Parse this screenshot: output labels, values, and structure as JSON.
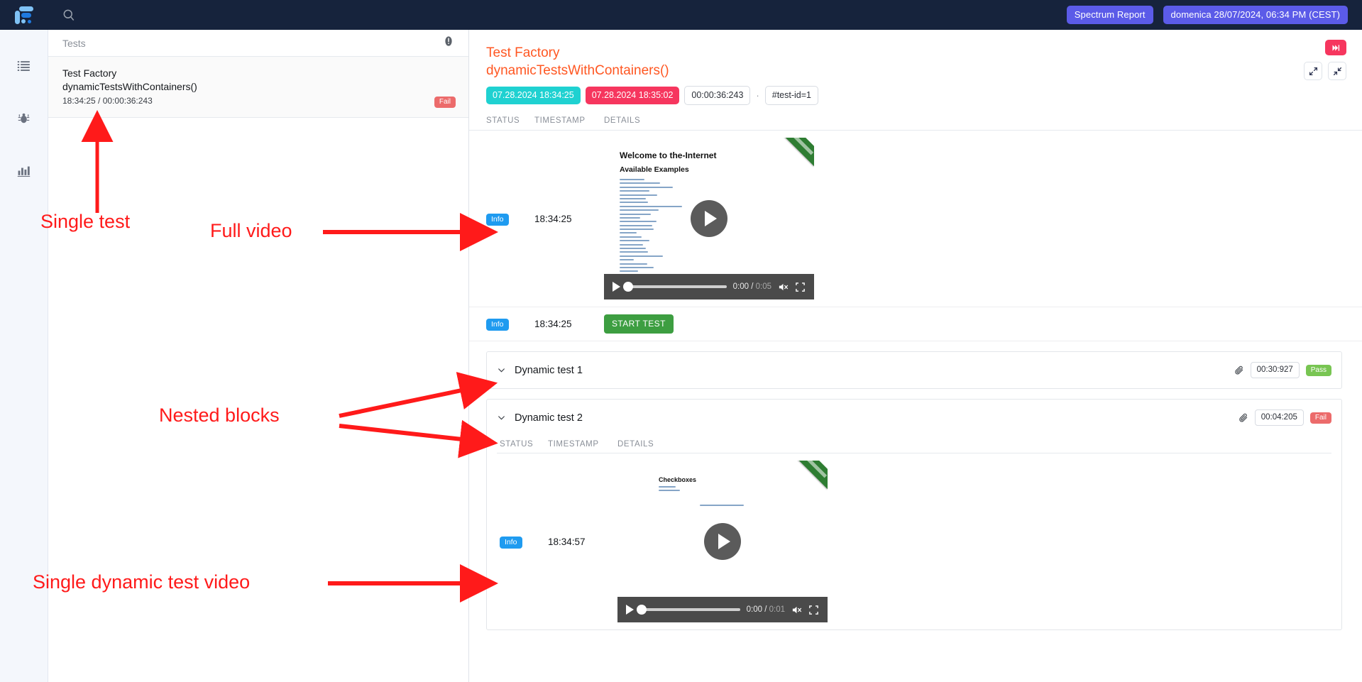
{
  "topbar": {
    "logo_name": "spectrum-logo",
    "search_icon": "search-icon",
    "report_label": "Spectrum Report",
    "datetime_label": "domenica 28/07/2024, 06:34 PM (CEST)",
    "accent_purple": "#5b5be8",
    "background": "#16233c"
  },
  "rail": {
    "items": [
      {
        "icon": "list-icon",
        "name": "sidebar-item-tests"
      },
      {
        "icon": "bug-icon",
        "name": "sidebar-item-defects"
      },
      {
        "icon": "bar-chart-icon",
        "name": "sidebar-item-statistics"
      }
    ]
  },
  "tests_panel": {
    "header_title": "Tests",
    "info_icon": "info-icon",
    "items": [
      {
        "suite": "Test Factory",
        "method": "dynamicTestsWithContainers()",
        "meta": "18:34:25 / 00:00:36:243",
        "status": "Fail",
        "status_color": "#ec6b6b"
      }
    ]
  },
  "detail": {
    "title_line1": "Test Factory",
    "title_line2": "dynamicTestsWithContainers()",
    "title_color": "#ff5722",
    "chips": {
      "start": "07.28.2024 18:34:25",
      "end": "07.28.2024 18:35:02",
      "duration": "00:00:36:243",
      "separator": "·",
      "test_id": "#test-id=1",
      "start_color": "#1fd1d1",
      "end_color": "#f6365e"
    },
    "tools": {
      "skip_icon": "skip-forward-icon",
      "expand_icon": "expand-arrows-icon",
      "collapse_icon": "collapse-arrows-icon"
    },
    "table_headers": {
      "status": "STATUS",
      "timestamp": "TIMESTAMP",
      "details": "DETAILS"
    },
    "rows": [
      {
        "status": "Info",
        "timestamp": "18:34:25",
        "kind": "video",
        "video": {
          "heading": "Welcome to the-Internet",
          "subheading": "Available Examples",
          "ribbon": "fork-me-ribbon",
          "current_time": "0:00",
          "total_time": "0:05",
          "play_icon": "play-icon",
          "mute_icon": "mute-icon",
          "fullscreen_icon": "fullscreen-icon"
        }
      },
      {
        "status": "Info",
        "timestamp": "18:34:25",
        "kind": "button",
        "button_label": "START TEST",
        "button_color": "#3d9e41"
      }
    ],
    "blocks": [
      {
        "chevron": "chevron-down-icon",
        "title": "Dynamic test 1",
        "attachment_icon": "paperclip-icon",
        "duration": "00:30:927",
        "status": "Pass",
        "status_color": "#78c552",
        "expanded": false
      },
      {
        "chevron": "chevron-down-icon",
        "title": "Dynamic test 2",
        "attachment_icon": "paperclip-icon",
        "duration": "00:04:205",
        "status": "Fail",
        "status_color": "#ec6b6b",
        "expanded": true,
        "table_headers": {
          "status": "STATUS",
          "timestamp": "TIMESTAMP",
          "details": "DETAILS"
        },
        "rows": [
          {
            "status": "Info",
            "timestamp": "18:34:57",
            "kind": "video",
            "video": {
              "heading": "Checkboxes",
              "subheading": "",
              "ribbon": "fork-me-ribbon",
              "current_time": "0:00",
              "total_time": "0:01",
              "play_icon": "play-icon",
              "mute_icon": "mute-icon",
              "fullscreen_icon": "fullscreen-icon"
            }
          }
        ]
      }
    ]
  },
  "annotations": [
    {
      "text": "Single test",
      "name": "annotation-single-test"
    },
    {
      "text": "Full video",
      "name": "annotation-full-video"
    },
    {
      "text": "Nested blocks",
      "name": "annotation-nested-blocks"
    },
    {
      "text": "Single dynamic test video",
      "name": "annotation-single-dynamic-test-video"
    }
  ],
  "annotation_color": "#ff1a1a"
}
